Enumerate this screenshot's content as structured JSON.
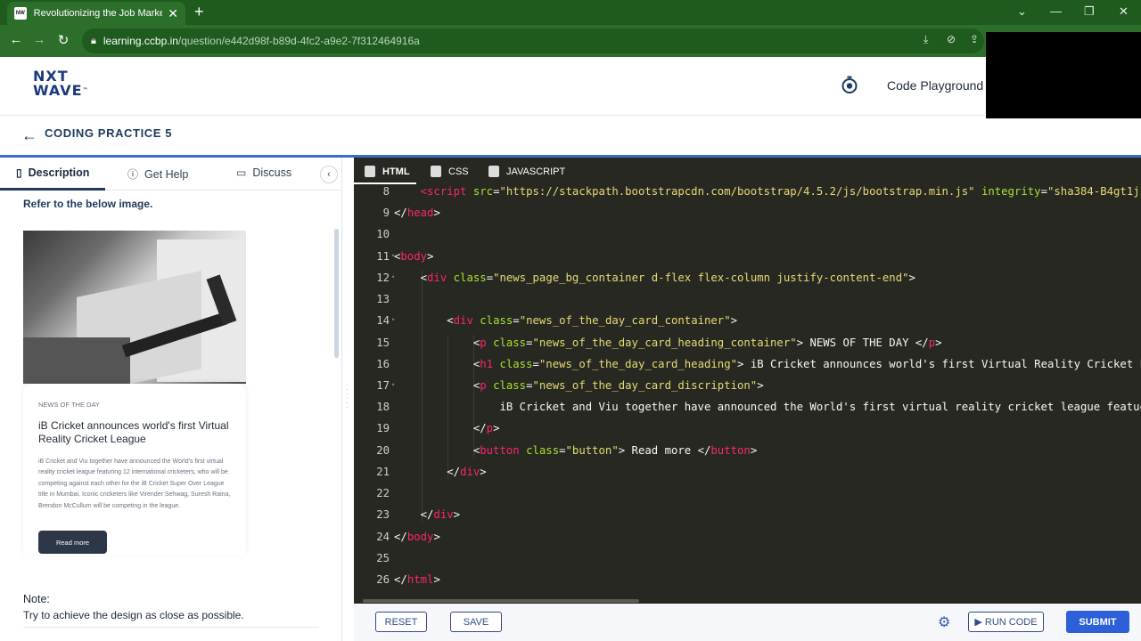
{
  "browser": {
    "tab_title": "Revolutionizing the Job Market |",
    "tab_close": "✕",
    "new_tab": "+",
    "url_host": "learning.ccbp.in",
    "url_path": "/question/e442d98f-b89d-4fc2-a9e2-7f312464916a",
    "window_controls": [
      "⌄",
      "—",
      "❐",
      "✕"
    ]
  },
  "header": {
    "logo_line1": "NXT",
    "logo_line2": "WAVE",
    "code_playground": "Code Playground"
  },
  "subheader": {
    "back": "←",
    "title": "CODING PRACTICE 5"
  },
  "left_tabs": {
    "description": "Description",
    "get_help": "Get Help",
    "discuss": "Discuss",
    "collapse": "‹"
  },
  "description": {
    "refer": "Refer to the below image.",
    "card": {
      "label": "NEWS OF THE DAY",
      "heading": "iB Cricket announces world's first Virtual Reality Cricket League",
      "desc": "iB Cricket and Viu together have announced the World's first virtual reality cricket league featuring 12 international cricketers, who will be competing against each other for the iB Cricket Super Over League title in Mumbai. Iconic cricketers like Virender Sehwag, Suresh Raina, Brendon McCullum will be competing in the league.",
      "button": "Read more"
    },
    "note_title": "Note:",
    "note_text": "Try to achieve the design as close as possible."
  },
  "editor": {
    "tabs": [
      "HTML",
      "CSS",
      "JAVASCRIPT"
    ],
    "line_numbers": [
      "8",
      "9",
      "10",
      "11",
      "12",
      "13",
      "14",
      "15",
      "16",
      "17",
      "18",
      "19",
      "20",
      "21",
      "22",
      "23",
      "24",
      "25",
      "26"
    ]
  },
  "actions": {
    "reset": "RESET",
    "save": "SAVE",
    "run_code": "▶ RUN CODE",
    "submit": "SUBMIT"
  },
  "colors": {
    "browser_green": "#2d6e2b",
    "brand_navy": "#1e3a5f",
    "accent_blue": "#2d5fd8",
    "editor_bg": "#272822"
  }
}
